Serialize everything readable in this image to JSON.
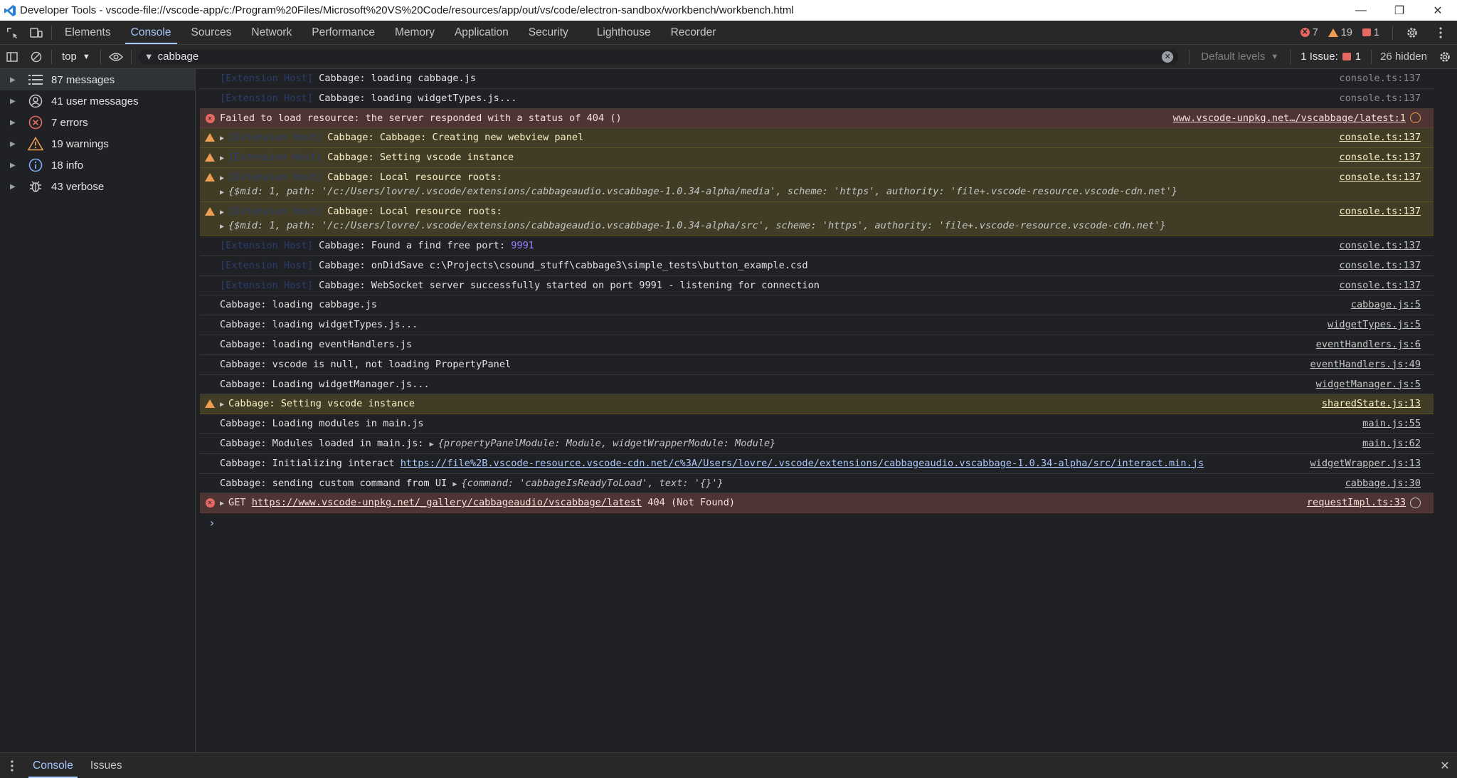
{
  "window": {
    "title": "Developer Tools - vscode-file://vscode-app/c:/Program%20Files/Microsoft%20VS%20Code/resources/app/out/vs/code/electron-sandbox/workbench/workbench.html",
    "minimize": "—",
    "maximize": "❐",
    "close": "✕"
  },
  "tabs": [
    "Elements",
    "Console",
    "Sources",
    "Network",
    "Performance",
    "Memory",
    "Application",
    "Security",
    "Lighthouse",
    "Recorder"
  ],
  "counts": {
    "errors": "7",
    "warnings": "19",
    "issues": "1"
  },
  "filterbar": {
    "context": "top",
    "filter_text": "cabbage",
    "levels": "Default levels",
    "issues": "1 Issue:",
    "issues_count": "1",
    "hidden": "26 hidden"
  },
  "sidebar": [
    {
      "label": "87 messages",
      "icon": "list-icon"
    },
    {
      "label": "41 user messages",
      "icon": "user-icon"
    },
    {
      "label": "7 errors",
      "icon": "error-icon"
    },
    {
      "label": "19 warnings",
      "icon": "warning-icon"
    },
    {
      "label": "18 info",
      "icon": "info-icon"
    },
    {
      "label": "43 verbose",
      "icon": "bug-icon"
    }
  ],
  "console": {
    "ext": "[Extension Host]",
    "m1": "Cabbage: loading cabbage.js",
    "m2": "Cabbage: loading widgetTypes.js...",
    "m3": "Failed to load resource: the server responded with a status of 404 ()",
    "m3_src": "www.vscode-unpkg.net…/vscabbage/latest:1",
    "m4": "Cabbage: Cabbage: Creating new webview panel",
    "m5": "Cabbage: Setting vscode instance",
    "m6": "Cabbage: Local resource roots:",
    "m6_obj": "{$mid: 1, path: '/c:/Users/lovre/.vscode/extensions/cabbageaudio.vscabbage-1.0.34-alpha/media', scheme: 'https', authority: 'file+.vscode-resource.vscode-cdn.net'}",
    "m7": "Cabbage: Local resource roots:",
    "m7_obj": "{$mid: 1, path: '/c:/Users/lovre/.vscode/extensions/cabbageaudio.vscabbage-1.0.34-alpha/src', scheme: 'https', authority: 'file+.vscode-resource.vscode-cdn.net'}",
    "m8": "Cabbage: Found a find free port: ",
    "m8_num": "9991",
    "m9": "Cabbage: onDidSave c:\\Projects\\csound_stuff\\cabbage3\\simple_tests\\button_example.csd",
    "m10": "Cabbage: WebSocket server successfully started on port 9991 - listening for connection",
    "m11": "Cabbage: loading cabbage.js",
    "m12": "Cabbage: loading widgetTypes.js...",
    "m13": "Cabbage: loading eventHandlers.js",
    "m14": "Cabbage: vscode is null, not loading PropertyPanel",
    "m15": "Cabbage: Loading widgetManager.js...",
    "m16": "Cabbage: Setting vscode instance",
    "m17": "Cabbage: Loading modules in main.js",
    "m18": "Cabbage: Modules loaded in main.js: ",
    "m18_obj": "{propertyPanelModule: Module, widgetWrapperModule: Module}",
    "m19": "Cabbage: Initializing interact ",
    "m19_link": "https://file%2B.vscode-resource.vscode-cdn.net/c%3A/Users/lovre/.vscode/extensions/cabbageaudio.vscabbage-1.0.34-alpha/src/interact.min.js",
    "m20": "Cabbage: sending custom command from UI ",
    "m20_obj": "{command: 'cabbageIsReadyToLoad', text: '{}'}",
    "m21_pre": "GET ",
    "m21_link": "https://www.vscode-unpkg.net/_gallery/cabbageaudio/vscabbage/latest",
    "m21_post": " 404 (Not Found)",
    "src_console": "console.ts:137",
    "src_cabbage5": "cabbage.js:5",
    "src_widgetTypes": "widgetTypes.js:5",
    "src_eh6": "eventHandlers.js:6",
    "src_eh49": "eventHandlers.js:49",
    "src_wm5": "widgetManager.js:5",
    "src_ss13": "sharedState.js:13",
    "src_main55": "main.js:55",
    "src_main62": "main.js:62",
    "src_ww13": "widgetWrapper.js:13",
    "src_cabbage30": "cabbage.js:30",
    "src_req33": "requestImpl.ts:33",
    "prompt": "›"
  },
  "drawer": {
    "tabs": [
      "Console",
      "Issues"
    ]
  }
}
